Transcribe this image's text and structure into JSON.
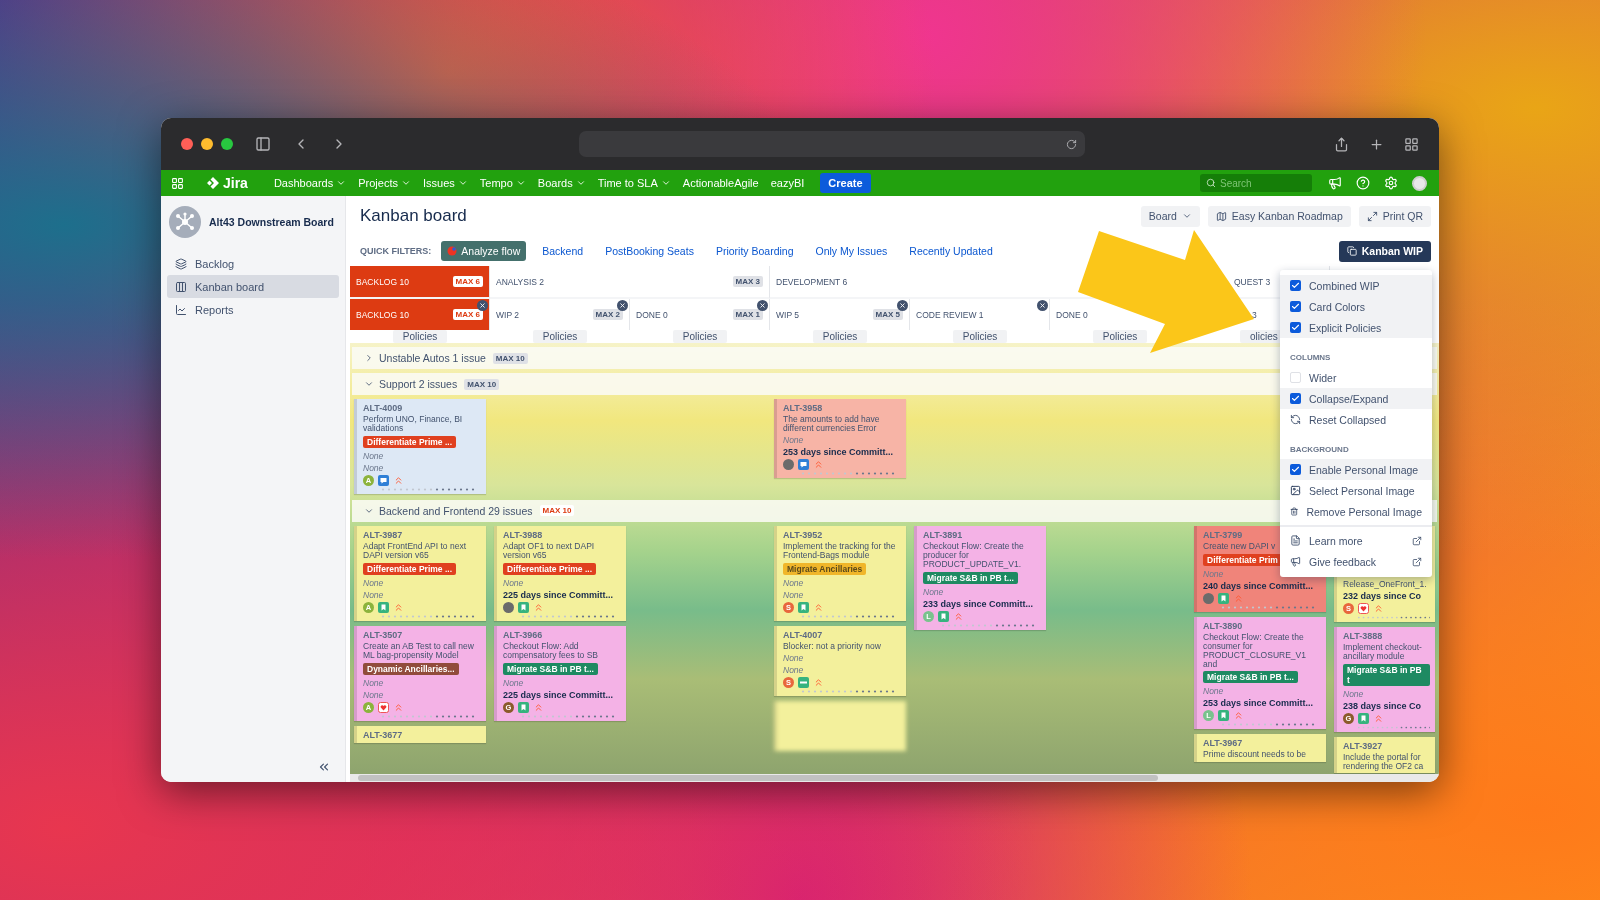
{
  "nav": {
    "logo": "Jira",
    "items": [
      {
        "label": "Dashboards",
        "dropdown": true
      },
      {
        "label": "Projects",
        "dropdown": true
      },
      {
        "label": "Issues",
        "dropdown": true
      },
      {
        "label": "Tempo",
        "dropdown": true
      },
      {
        "label": "Boards",
        "dropdown": true
      },
      {
        "label": "Time to SLA",
        "dropdown": true
      },
      {
        "label": "ActionableAgile",
        "dropdown": false
      },
      {
        "label": "eazyBI",
        "dropdown": false
      }
    ],
    "create": "Create",
    "search": {
      "placeholder": "Search"
    }
  },
  "sidebar": {
    "project": "Alt43 Downstream Board",
    "items": [
      {
        "label": "Backlog",
        "kind": "backlog",
        "selected": false
      },
      {
        "label": "Kanban board",
        "kind": "board",
        "selected": true
      },
      {
        "label": "Reports",
        "kind": "reports",
        "selected": false
      }
    ]
  },
  "page": {
    "title": "Kanban board",
    "actions": [
      {
        "label": "Board",
        "kind": "dropdown"
      },
      {
        "label": "Easy Kanban Roadmap",
        "kind": "roadmap"
      },
      {
        "label": "Print QR",
        "kind": "print"
      }
    ],
    "wip_button": "Kanban WIP"
  },
  "quick_filters": {
    "label": "QUICK FILTERS:",
    "items": [
      {
        "label": "Analyze flow",
        "selected": true
      },
      {
        "label": "Backend",
        "selected": false
      },
      {
        "label": "PostBooking Seats",
        "selected": false
      },
      {
        "label": "Priority Boarding",
        "selected": false
      },
      {
        "label": "Only My Issues",
        "selected": false
      },
      {
        "label": "Recently Updated",
        "selected": false
      }
    ]
  },
  "board": {
    "groups": [
      {
        "label": "BACKLOG 10",
        "max": "MAX 6",
        "over": true,
        "partly_hidden": false,
        "columns": [
          {
            "label": "BACKLOG 10",
            "max": "MAX 6",
            "over": true,
            "collapsible": true,
            "partly_hidden": false,
            "policies": "Policies"
          }
        ]
      },
      {
        "label": "ANALYSIS 2",
        "max": "MAX 3",
        "over": false,
        "partly_hidden": false,
        "columns": [
          {
            "label": "WIP 2",
            "max": "MAX 2",
            "over": false,
            "collapsible": true,
            "partly_hidden": false,
            "policies": "Policies"
          },
          {
            "label": "DONE 0",
            "max": "MAX 1",
            "over": false,
            "collapsible": true,
            "partly_hidden": false,
            "policies": "Policies"
          }
        ]
      },
      {
        "label": "DEVELOPMENT 6",
        "over": false,
        "partly_hidden": false,
        "columns": [
          {
            "label": "WIP 5",
            "max": "MAX 5",
            "over": false,
            "collapsible": true,
            "partly_hidden": false,
            "policies": "Policies"
          },
          {
            "label": "CODE REVIEW 1",
            "over": false,
            "collapsible": true,
            "partly_hidden": false,
            "policies": "Policies"
          },
          {
            "label": "DONE 0",
            "over": false,
            "partly_hidden": false,
            "policies": "Policies"
          }
        ]
      },
      {
        "label": "QUEST 3",
        "over": false,
        "partly_hidden": true,
        "columns": [
          {
            "label": "3",
            "over": false,
            "partly_hidden": true,
            "policies": "olicies"
          }
        ]
      }
    ],
    "lanes": [
      {
        "title": "Unstable Autos 1 issue",
        "max": "MAX 10",
        "over": false,
        "expanded": false
      },
      {
        "title": "Support 2 issues",
        "max": "MAX 10",
        "over": false,
        "expanded": true,
        "columns": [
          [
            {
              "kind": "card",
              "id": "ALT-4009",
              "title": "Perform UNO, Finance, BI validations",
              "color": "#dde8f5",
              "epic": {
                "text": "Differentiate Prime ...",
                "color": "#e0401f"
              },
              "lines": [
                {
                  "kind": "none",
                  "text": "None"
                },
                {
                  "kind": "none",
                  "text": "None"
                }
              ],
              "avatar": {
                "kind": "letter",
                "letter": "A",
                "color": "#8cb33c"
              },
              "issue_icon": {
                "kind": "support"
              }
            }
          ],
          [],
          [],
          [
            {
              "kind": "card",
              "id": "ALT-3958",
              "title": "The amounts to add have different currencies Error",
              "color": "#f7b4a6",
              "lines": [
                {
                  "kind": "none",
                  "text": "None"
                },
                {
                  "kind": "age",
                  "text": "253 days since Committ..."
                }
              ],
              "avatar": {
                "kind": "photo"
              },
              "issue_icon": {
                "kind": "support"
              }
            }
          ],
          [],
          [],
          [],
          []
        ]
      },
      {
        "title": "Backend and Frontend 29 issues",
        "max": "MAX 10",
        "over": true,
        "expanded": true,
        "columns": [
          [
            {
              "kind": "card",
              "id": "ALT-3987",
              "title": "Adapt FrontEnd API to next DAPI version v65",
              "color": "#f3f09c",
              "epic": {
                "text": "Differentiate Prime ...",
                "color": "#e0401f"
              },
              "lines": [
                {
                  "kind": "none",
                  "text": "None"
                },
                {
                  "kind": "none",
                  "text": "None"
                }
              ],
              "avatar": {
                "kind": "letter",
                "letter": "A",
                "color": "#8cb33c"
              },
              "issue_icon": {
                "kind": "story"
              }
            },
            {
              "kind": "card",
              "id": "ALT-3507",
              "title": "Create an AB Test to call new ML bag-propensity Model",
              "color": "#f4b2e6",
              "epic": {
                "text": "Dynamic Ancillaries...",
                "color": "#914c3c"
              },
              "lines": [
                {
                  "kind": "none",
                  "text": "None"
                },
                {
                  "kind": "none",
                  "text": "None"
                }
              ],
              "avatar": {
                "kind": "letter",
                "letter": "A",
                "color": "#8cb33c"
              },
              "issue_icon": {
                "kind": "heart"
              }
            },
            {
              "kind": "cut",
              "id": "ALT-3677",
              "color": "#f3f09c"
            }
          ],
          [
            {
              "kind": "card",
              "id": "ALT-3988",
              "title": "Adapt OF1 to next DAPI version v65",
              "color": "#f3f09c",
              "epic": {
                "text": "Differentiate Prime ...",
                "color": "#e0401f"
              },
              "lines": [
                {
                  "kind": "none",
                  "text": "None"
                },
                {
                  "kind": "age",
                  "text": "225 days since Committ..."
                }
              ],
              "avatar": {
                "kind": "photo"
              },
              "issue_icon": {
                "kind": "story"
              }
            },
            {
              "kind": "card",
              "id": "ALT-3966",
              "title": "Checkout Flow: Add compensatory fees to SB",
              "color": "#f4b2e6",
              "epic": {
                "text": "Migrate S&B in PB t...",
                "color": "#1e8a62"
              },
              "lines": [
                {
                  "kind": "none",
                  "text": "None"
                },
                {
                  "kind": "age",
                  "text": "225 days since Committ..."
                }
              ],
              "avatar": {
                "kind": "letter",
                "letter": "G",
                "color": "#8b5a2b"
              },
              "issue_icon": {
                "kind": "story"
              }
            }
          ],
          [],
          [
            {
              "kind": "card",
              "id": "ALT-3952",
              "title": "Implement the tracking for the Frontend-Bags module",
              "color": "#f3f09c",
              "epic": {
                "text": "Migrate Ancillaries",
                "color": "#f0b62a"
              },
              "lines": [
                {
                  "kind": "none",
                  "text": "None"
                },
                {
                  "kind": "none",
                  "text": "None"
                }
              ],
              "avatar": {
                "kind": "letter",
                "letter": "S",
                "color": "#e8673c"
              },
              "issue_icon": {
                "kind": "story"
              }
            },
            {
              "kind": "card",
              "id": "ALT-4007",
              "title": "Blocker: not a priority now",
              "color": "#f3f09c",
              "lines": [
                {
                  "kind": "none",
                  "text": "None"
                },
                {
                  "kind": "none",
                  "text": "None"
                }
              ],
              "avatar": {
                "kind": "letter",
                "letter": "S",
                "color": "#e8673c"
              },
              "issue_icon": {
                "kind": "task"
              }
            },
            {
              "kind": "blurred",
              "color": "#f3f09c"
            }
          ],
          [
            {
              "kind": "card",
              "id": "ALT-3891",
              "title": "Checkout Flow: Create the producer for PRODUCT_UPDATE_V1.",
              "color": "#f4b2e6",
              "epic": {
                "text": "Migrate S&B in PB t...",
                "color": "#1e8a62"
              },
              "lines": [
                {
                  "kind": "none",
                  "text": "None"
                },
                {
                  "kind": "age",
                  "text": "233 days since Committ..."
                }
              ],
              "avatar": {
                "kind": "letter",
                "letter": "L",
                "color": "#79c28d"
              },
              "issue_icon": {
                "kind": "story"
              }
            }
          ],
          [],
          [
            {
              "kind": "card",
              "id": "ALT-3799",
              "title": "Create new DAPI v",
              "color": "#f0847a",
              "epic": {
                "text": "Differentiate Prim",
                "color": "#e0401f"
              },
              "lines": [
                {
                  "kind": "none",
                  "text": "None"
                },
                {
                  "kind": "age",
                  "text": "240 days since Committ..."
                }
              ],
              "avatar": {
                "kind": "photo"
              },
              "issue_icon": {
                "kind": "story"
              }
            },
            {
              "kind": "card",
              "id": "ALT-3890",
              "title": "Checkout Flow: Create the consumer for PRODUCT_CLOSURE_V1 and",
              "color": "#f4b2e6",
              "epic": {
                "text": "Migrate S&B in PB t...",
                "color": "#1e8a62"
              },
              "lines": [
                {
                  "kind": "none",
                  "text": "None"
                },
                {
                  "kind": "age",
                  "text": "253 days since Committ..."
                }
              ],
              "avatar": {
                "kind": "letter",
                "letter": "L",
                "color": "#79c28d"
              },
              "issue_icon": {
                "kind": "story"
              }
            },
            {
              "kind": "cut",
              "id": "ALT-3967",
              "title": "Prime discount needs to be",
              "color": "#f3f09c"
            }
          ],
          [
            {
              "kind": "covered",
              "title": "Release_OneFront_1.",
              "color": "#f3f09c",
              "lines": [
                {
                  "kind": "age",
                  "text": "232 days since Co"
                }
              ],
              "avatar": {
                "kind": "letter",
                "letter": "S",
                "color": "#e8673c"
              },
              "issue_icon": {
                "kind": "heart"
              }
            },
            {
              "kind": "card",
              "id": "ALT-3888",
              "title": "Implement checkout-ancillary module",
              "color": "#f4b2e6",
              "epic": {
                "text": "Migrate S&B in PB t",
                "color": "#1e8a62"
              },
              "lines": [
                {
                  "kind": "none",
                  "text": "None"
                },
                {
                  "kind": "age",
                  "text": "238 days since Co"
                }
              ],
              "avatar": {
                "kind": "letter",
                "letter": "G",
                "color": "#8b5a2b"
              },
              "issue_icon": {
                "kind": "story"
              }
            },
            {
              "kind": "cut",
              "id": "ALT-3927",
              "title": "Include the portal for rendering the OF2 ca",
              "color": "#f3f09c"
            }
          ]
        ]
      }
    ]
  },
  "wip_menu": {
    "sections": [
      {
        "items": [
          {
            "kind": "checkbox",
            "label": "Combined WIP",
            "checked": true,
            "highlighted": true
          },
          {
            "kind": "checkbox",
            "label": "Card Colors",
            "checked": true,
            "highlighted": true
          },
          {
            "kind": "checkbox",
            "label": "Explicit Policies",
            "checked": true,
            "highlighted": true
          }
        ]
      },
      {
        "heading": "COLUMNS",
        "items": [
          {
            "kind": "checkbox",
            "label": "Wider",
            "checked": false,
            "highlighted": false
          },
          {
            "kind": "checkbox",
            "label": "Collapse/Expand",
            "checked": true,
            "highlighted": true
          },
          {
            "kind": "reset",
            "label": "Reset Collapsed",
            "highlighted": false
          }
        ]
      },
      {
        "heading": "BACKGROUND",
        "items": [
          {
            "kind": "checkbox",
            "label": "Enable Personal Image",
            "checked": true,
            "highlighted": true
          },
          {
            "kind": "image",
            "label": "Select Personal Image",
            "highlighted": false
          },
          {
            "kind": "trash",
            "label": "Remove Personal Image",
            "highlighted": false
          }
        ]
      },
      {
        "items": [
          {
            "kind": "docs",
            "label": "Learn more",
            "external": true,
            "highlighted": false
          },
          {
            "kind": "feedback",
            "label": "Give feedback",
            "external": true,
            "highlighted": false
          }
        ]
      }
    ]
  }
}
